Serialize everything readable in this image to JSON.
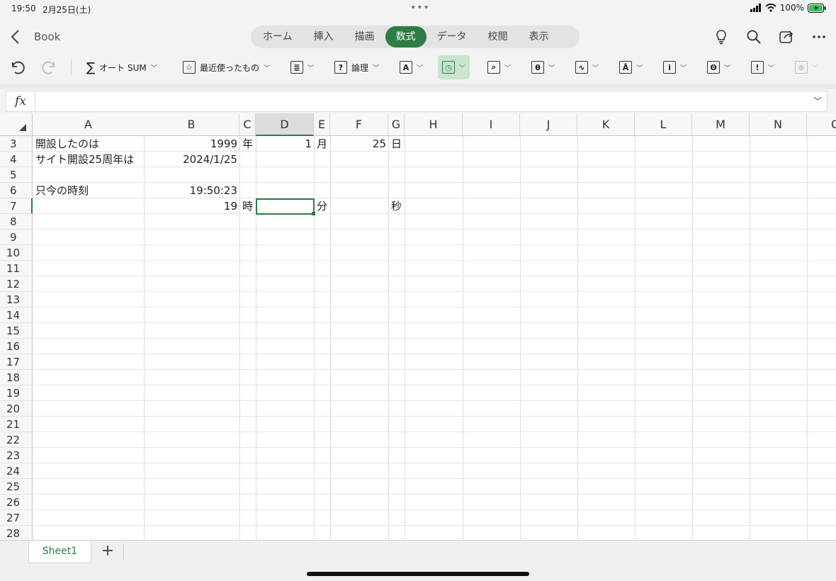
{
  "status_bar": {
    "time": "19:50",
    "date": "2月25日(土)",
    "battery": "100%",
    "dots": "•••"
  },
  "title_bar": {
    "back_icon": "chevron-left-icon",
    "doc_name": "Book"
  },
  "tabs": [
    {
      "label": "ホーム",
      "active": false
    },
    {
      "label": "挿入",
      "active": false
    },
    {
      "label": "描画",
      "active": false
    },
    {
      "label": "数式",
      "active": true
    },
    {
      "label": "データ",
      "active": false
    },
    {
      "label": "校閲",
      "active": false
    },
    {
      "label": "表示",
      "active": false
    }
  ],
  "ribbon": {
    "autosum_label": "オート SUM",
    "recent_label": "最近使ったもの",
    "logic_label": "論理"
  },
  "formula_bar": {
    "fx": "fx",
    "value": ""
  },
  "columns": [
    "A",
    "B",
    "C",
    "D",
    "E",
    "F",
    "G",
    "H",
    "I",
    "J",
    "K",
    "L",
    "M",
    "N",
    "O"
  ],
  "selected_column": "D",
  "rows": [
    "3",
    "4",
    "5",
    "6",
    "7",
    "8",
    "9",
    "10",
    "11",
    "12",
    "13",
    "14",
    "15",
    "16",
    "17",
    "18",
    "19",
    "20",
    "21",
    "22",
    "23",
    "24",
    "25",
    "26",
    "27",
    "28"
  ],
  "selected_row": "7",
  "cells": {
    "A3": "開設したのは",
    "B3": "1999",
    "C3": "年",
    "D3": "1",
    "E3": "月",
    "F3": "25",
    "G3": "日",
    "A4": "サイト開設25周年は",
    "B4": "2024/1/25",
    "A6": "只今の時刻",
    "B6": "19:50:23",
    "B7": "19",
    "C7": "時",
    "E7": "分",
    "G7": "秒"
  },
  "sheet_tabs": [
    "Sheet1"
  ],
  "accent_color": "#2e7d46"
}
